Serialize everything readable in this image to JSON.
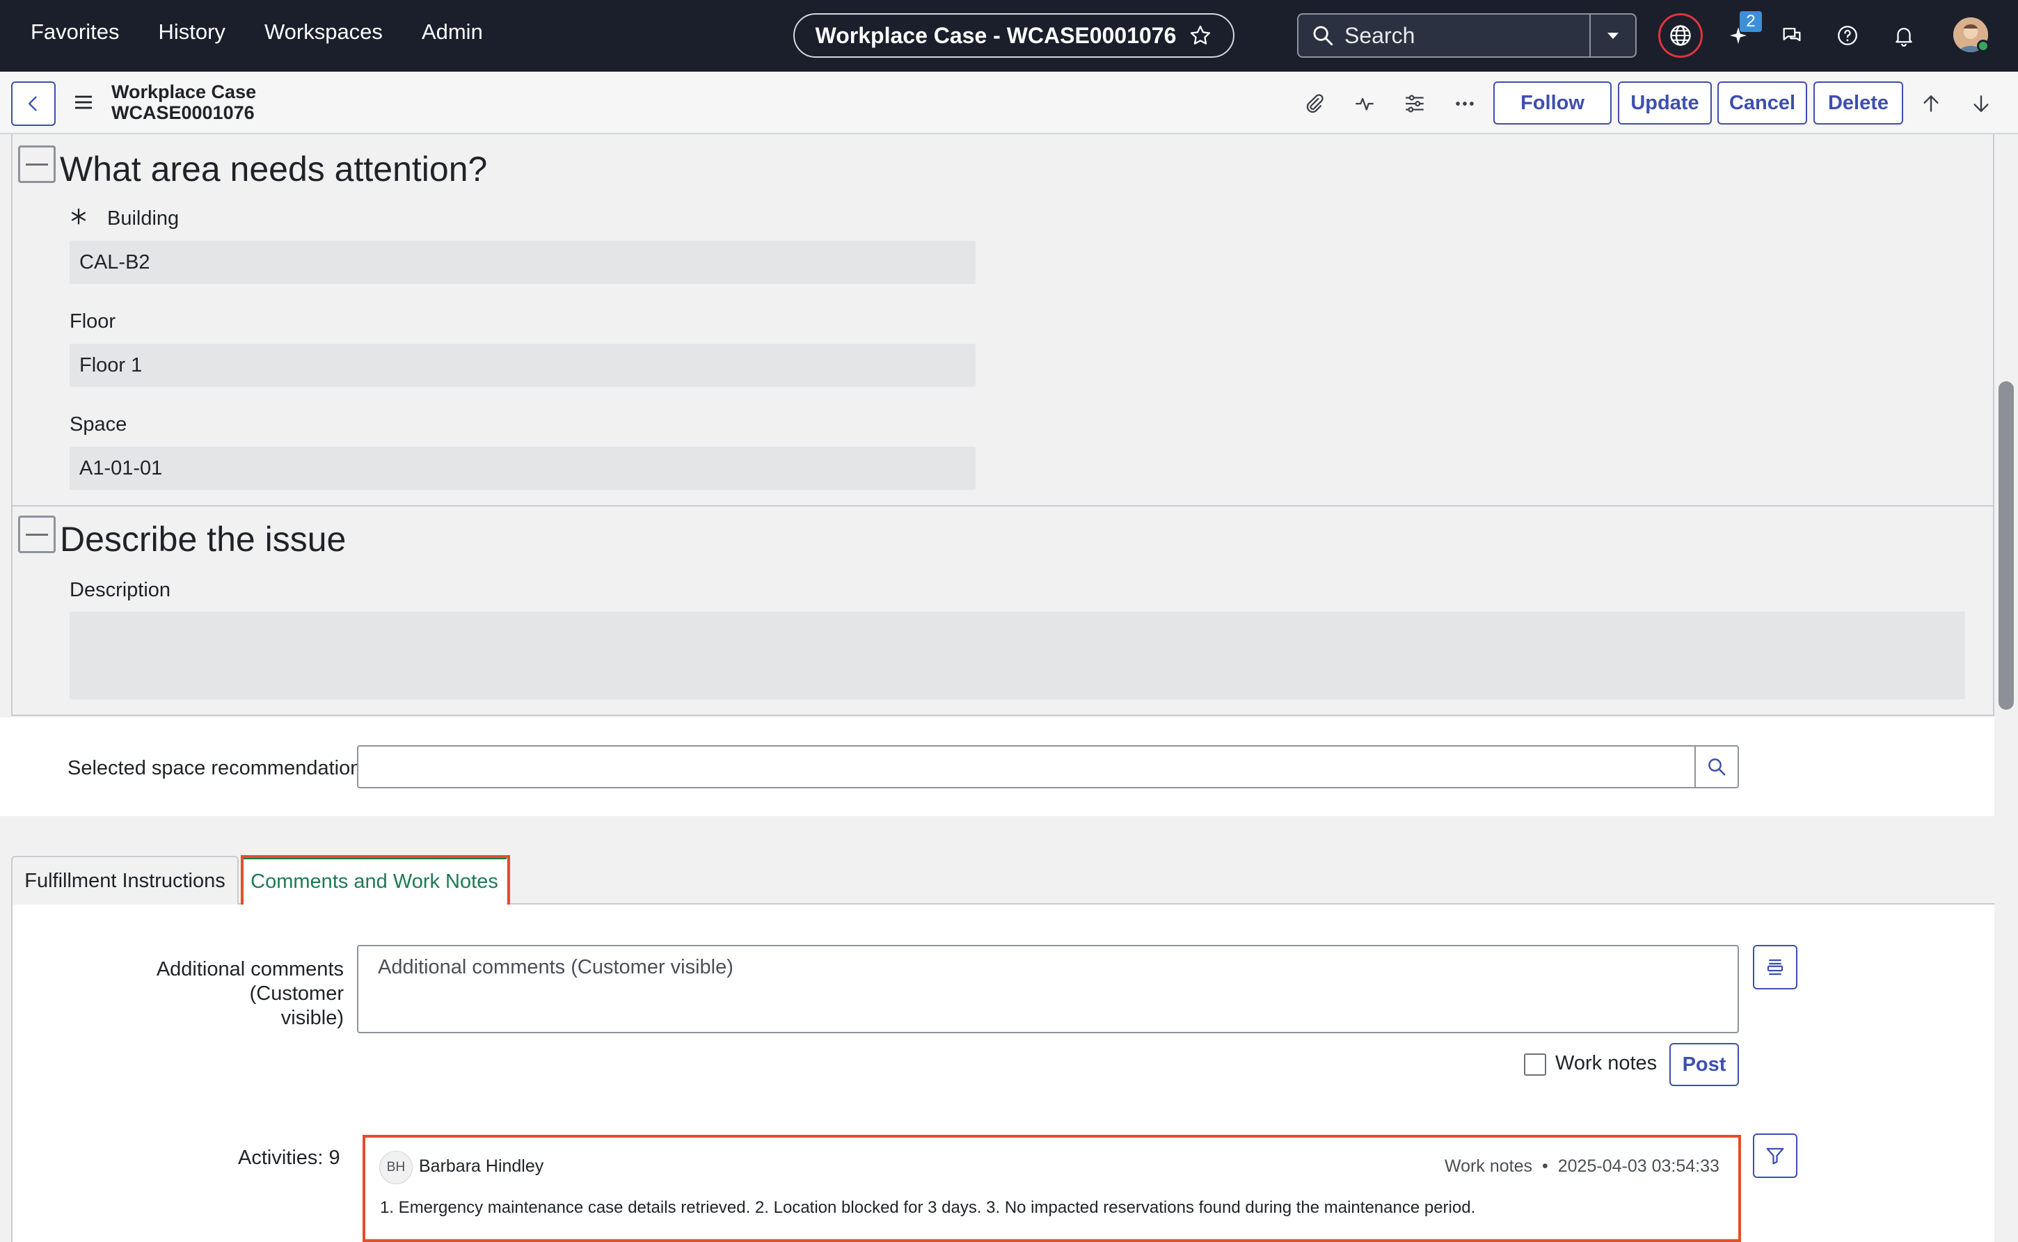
{
  "nav": {
    "menu": [
      "Favorites",
      "History",
      "Workspaces",
      "Admin"
    ],
    "record_title": "Workplace Case - WCASE0001076",
    "search_placeholder": "Search",
    "notification_badge": "2"
  },
  "form_header": {
    "title_line1": "Workplace Case",
    "title_line2": "WCASE0001076",
    "buttons": {
      "follow": "Follow",
      "update": "Update",
      "cancel": "Cancel",
      "delete": "Delete"
    }
  },
  "sections": {
    "area": {
      "title": "What area needs attention?",
      "building_label": "Building",
      "building_value": "CAL-B2",
      "floor_label": "Floor",
      "floor_value": "Floor 1",
      "space_label": "Space",
      "space_value": "A1-01-01"
    },
    "issue": {
      "title": "Describe the issue",
      "description_label": "Description",
      "description_value": ""
    }
  },
  "recommendation": {
    "label": "Selected space recommendation",
    "value": ""
  },
  "tabs": [
    "Fulfillment Instructions",
    "Comments and Work Notes"
  ],
  "comments": {
    "label_line1": "Additional comments (Customer",
    "label_line2": "visible)",
    "placeholder": "Additional comments (Customer visible)",
    "work_notes_label": "Work notes",
    "post_label": "Post"
  },
  "activities": {
    "label": "Activities: 9",
    "entries": [
      {
        "initials": "BH",
        "author": "Barbara Hindley",
        "type": "Work notes",
        "timestamp": "2025-04-03 03:54:33",
        "text": "1. Emergency maintenance case details retrieved. 2. Location blocked for 3 days. 3. No impacted reservations found during the maintenance period."
      }
    ]
  },
  "colors": {
    "nav_bg": "#1a1f2b",
    "accent": "#3d4fae",
    "tab_active": "#1e7a52",
    "highlight": "#e44d2e"
  }
}
